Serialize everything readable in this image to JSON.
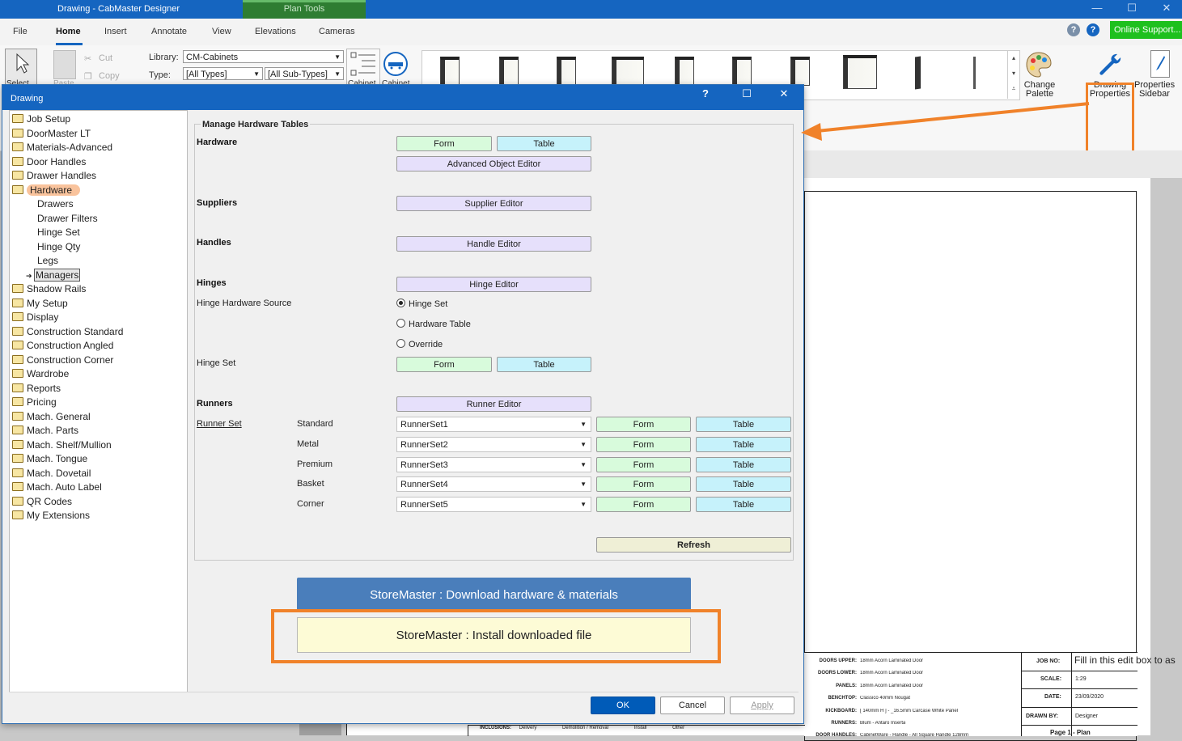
{
  "app": {
    "window_title": "Drawing - CabMaster Designer",
    "context_tab": "Plan Tools",
    "window_controls": {
      "minimize": "—",
      "maximize": "☐",
      "close": "✕"
    }
  },
  "menu": {
    "tabs": [
      "File",
      "Home",
      "Insert",
      "Annotate",
      "View",
      "Elevations",
      "Cameras"
    ],
    "active": "Home",
    "online_support": "Online Support..."
  },
  "ribbon": {
    "select_label": "Select",
    "paste_label": "Paste",
    "cut_label": "Cut",
    "copy_label": "Copy",
    "library_label": "Library:",
    "library_value": "CM-Cabinets",
    "type_label": "Type:",
    "type_value": "[All Types]",
    "subtype_value": "[All Sub-Types]",
    "cabinet_label_1": "Cabinet",
    "cabinet_label_2": "Cabinet",
    "change_palette": "Change Palette",
    "drawing_properties": "Drawing Properties",
    "properties_sidebar": "Properties Sidebar"
  },
  "dialog": {
    "title": "Drawing",
    "tree": [
      {
        "label": "Job Setup",
        "level": 0
      },
      {
        "label": "DoorMaster LT",
        "level": 0
      },
      {
        "label": "Materials-Advanced",
        "level": 0
      },
      {
        "label": "Door Handles",
        "level": 0
      },
      {
        "label": "Drawer Handles",
        "level": 0
      },
      {
        "label": "Hardware",
        "level": 0,
        "selected": true
      },
      {
        "label": "Drawers",
        "level": 1
      },
      {
        "label": "Drawer Filters",
        "level": 1
      },
      {
        "label": "Hinge Set",
        "level": 1
      },
      {
        "label": "Hinge Qty",
        "level": 1
      },
      {
        "label": "Legs",
        "level": 1
      },
      {
        "label": "Managers",
        "level": 1,
        "current": true
      },
      {
        "label": "Shadow Rails",
        "level": 0
      },
      {
        "label": "My Setup",
        "level": 0
      },
      {
        "label": "Display",
        "level": 0
      },
      {
        "label": "Construction Standard",
        "level": 0
      },
      {
        "label": "Construction Angled",
        "level": 0
      },
      {
        "label": "Construction Corner",
        "level": 0
      },
      {
        "label": "Wardrobe",
        "level": 0
      },
      {
        "label": "Reports",
        "level": 0
      },
      {
        "label": "Pricing",
        "level": 0
      },
      {
        "label": "Mach. General",
        "level": 0
      },
      {
        "label": "Mach. Parts",
        "level": 0
      },
      {
        "label": "Mach. Shelf/Mullion",
        "level": 0
      },
      {
        "label": "Mach. Tongue",
        "level": 0
      },
      {
        "label": "Mach. Dovetail",
        "level": 0
      },
      {
        "label": "Mach. Auto Label",
        "level": 0
      },
      {
        "label": "QR Codes",
        "level": 0
      },
      {
        "label": "My Extensions",
        "level": 0
      }
    ],
    "group_title": "Manage Hardware Tables",
    "hardware": {
      "label": "Hardware",
      "form": "Form",
      "table": "Table",
      "advanced": "Advanced Object Editor"
    },
    "suppliers": {
      "label": "Suppliers",
      "editor": "Supplier Editor"
    },
    "handles": {
      "label": "Handles",
      "editor": "Handle Editor"
    },
    "hinges": {
      "label": "Hinges",
      "editor": "Hinge Editor",
      "source_label": "Hinge Hardware Source",
      "options": [
        "Hinge Set",
        "Hardware Table",
        "Override"
      ],
      "selected": "Hinge Set",
      "set_label": "Hinge Set",
      "form": "Form",
      "table": "Table"
    },
    "runners": {
      "label": "Runners",
      "editor": "Runner Editor",
      "set_label": "Runner Set",
      "rows": [
        {
          "name": "Standard",
          "value": "RunnerSet1",
          "form": "Form",
          "table": "Table"
        },
        {
          "name": "Metal",
          "value": "RunnerSet2",
          "form": "Form",
          "table": "Table"
        },
        {
          "name": "Premium",
          "value": "RunnerSet3",
          "form": "Form",
          "table": "Table"
        },
        {
          "name": "Basket",
          "value": "RunnerSet4",
          "form": "Form",
          "table": "Table"
        },
        {
          "name": "Corner",
          "value": "RunnerSet5",
          "form": "Form",
          "table": "Table"
        }
      ],
      "refresh": "Refresh"
    },
    "storemaster_download": "StoreMaster : Download hardware & materials",
    "storemaster_install": "StoreMaster : Install downloaded file",
    "ok": "OK",
    "cancel": "Cancel",
    "apply": "Apply"
  },
  "title_block": {
    "fill_hint": "Fill in this edit box to as",
    "rows": [
      {
        "key": "DOORS UPPER:",
        "value": "18mm Acorn Laminated Door"
      },
      {
        "key": "DOORS LOWER:",
        "value": "18mm Acorn Laminated Door"
      },
      {
        "key": "PANELS:",
        "value": "18mm Acorn Laminated Door"
      },
      {
        "key": "BENCHTOP:",
        "value": "Classico 40mm Nougat"
      },
      {
        "key": "KICKBOARD:",
        "value": "[ 140mm H ] - _16.5mm Carcase White Panel"
      },
      {
        "key": "RUNNERS:",
        "value": "Blum - Antaro Inserta"
      },
      {
        "key": "DOOR HANDLES:",
        "value": "CabinetWare - Handle - All Square Handle 128mm"
      }
    ],
    "job_no": "JOB NO:",
    "scale_label": "SCALE:",
    "scale_value": "1:29",
    "date_label": "DATE:",
    "date_value": "23/09/2020",
    "drawn_by_label": "DRAWN BY:",
    "drawn_by_value": "Designer",
    "page": "Page 1 - Plan",
    "inclusions_label": "INCLUSIONS:",
    "inclusions": [
      "Delivery",
      "Demolition / Removal",
      "Install",
      "Other"
    ]
  },
  "colors": {
    "titlebar": "#1565c0",
    "highlight": "#f0822a",
    "online_support": "#1ec01e",
    "form_button": "#d8fbdc",
    "table_button": "#c6f2fb",
    "editor_button": "#e6e0fb"
  }
}
